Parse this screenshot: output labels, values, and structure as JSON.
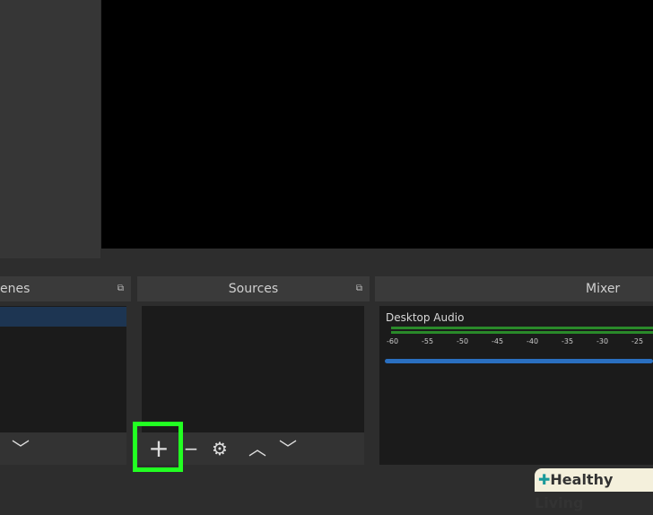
{
  "scenes": {
    "title": "enes"
  },
  "sources": {
    "title": "Sources",
    "add": "+",
    "remove": "−",
    "settings": "⚙",
    "up": "︿",
    "down": "﹀"
  },
  "mixer": {
    "title": "Mixer",
    "channel": "Desktop Audio",
    "ticks": [
      "-60",
      "-55",
      "-50",
      "-45",
      "-40",
      "-35",
      "-30",
      "-25"
    ]
  },
  "watermark": "Healthy Living",
  "colors": {
    "highlight": "#22ff22",
    "meter": "#2a8a2a",
    "volume": "#2a6fc0",
    "selected": "#1d3552"
  }
}
